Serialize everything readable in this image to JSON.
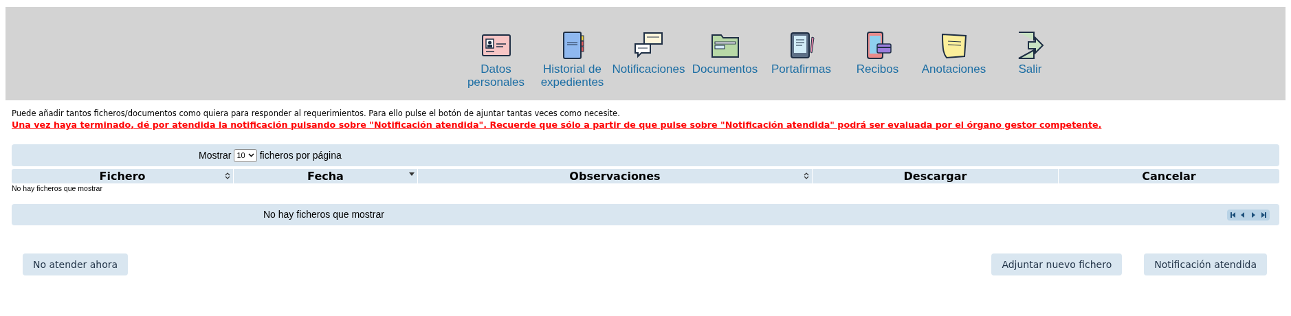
{
  "nav": [
    {
      "label": "Datos personales"
    },
    {
      "label": "Historial de expedientes"
    },
    {
      "label": "Notificaciones"
    },
    {
      "label": "Documentos"
    },
    {
      "label": "Portafirmas"
    },
    {
      "label": "Recibos"
    },
    {
      "label": "Anotaciones"
    },
    {
      "label": "Salir"
    }
  ],
  "info": "Puede añadir tantos ficheros/documentos como quiera para responder al requerimientos. Para ello pulse el botón de ajuntar tantas veces como necesite.",
  "warning": "Una vez haya terminado, dé por atendida la notificación pulsando sobre \"Notificación atendida\". Recuerde que sólo a partir de que pulse sobre \"Notificación atendida\" podrá ser evaluada por el órgano gestor competente.",
  "length_menu": {
    "before": "Mostrar",
    "value": "10",
    "after": "ficheros por página"
  },
  "table": {
    "columns": [
      {
        "label": "Fichero",
        "kind": "sortable"
      },
      {
        "label": "Fecha",
        "kind": "sorted"
      },
      {
        "label": "Observaciones",
        "kind": "sortable"
      },
      {
        "label": "Descargar",
        "kind": "plain"
      },
      {
        "label": "Cancelar",
        "kind": "plain"
      }
    ],
    "empty": "No hay ficheros que mostrar"
  },
  "footer": {
    "info": "No hay ficheros que mostrar"
  },
  "buttons": {
    "left": [
      "No atender ahora"
    ],
    "right": [
      "Adjuntar nuevo fichero",
      "Notificación atendida"
    ]
  }
}
